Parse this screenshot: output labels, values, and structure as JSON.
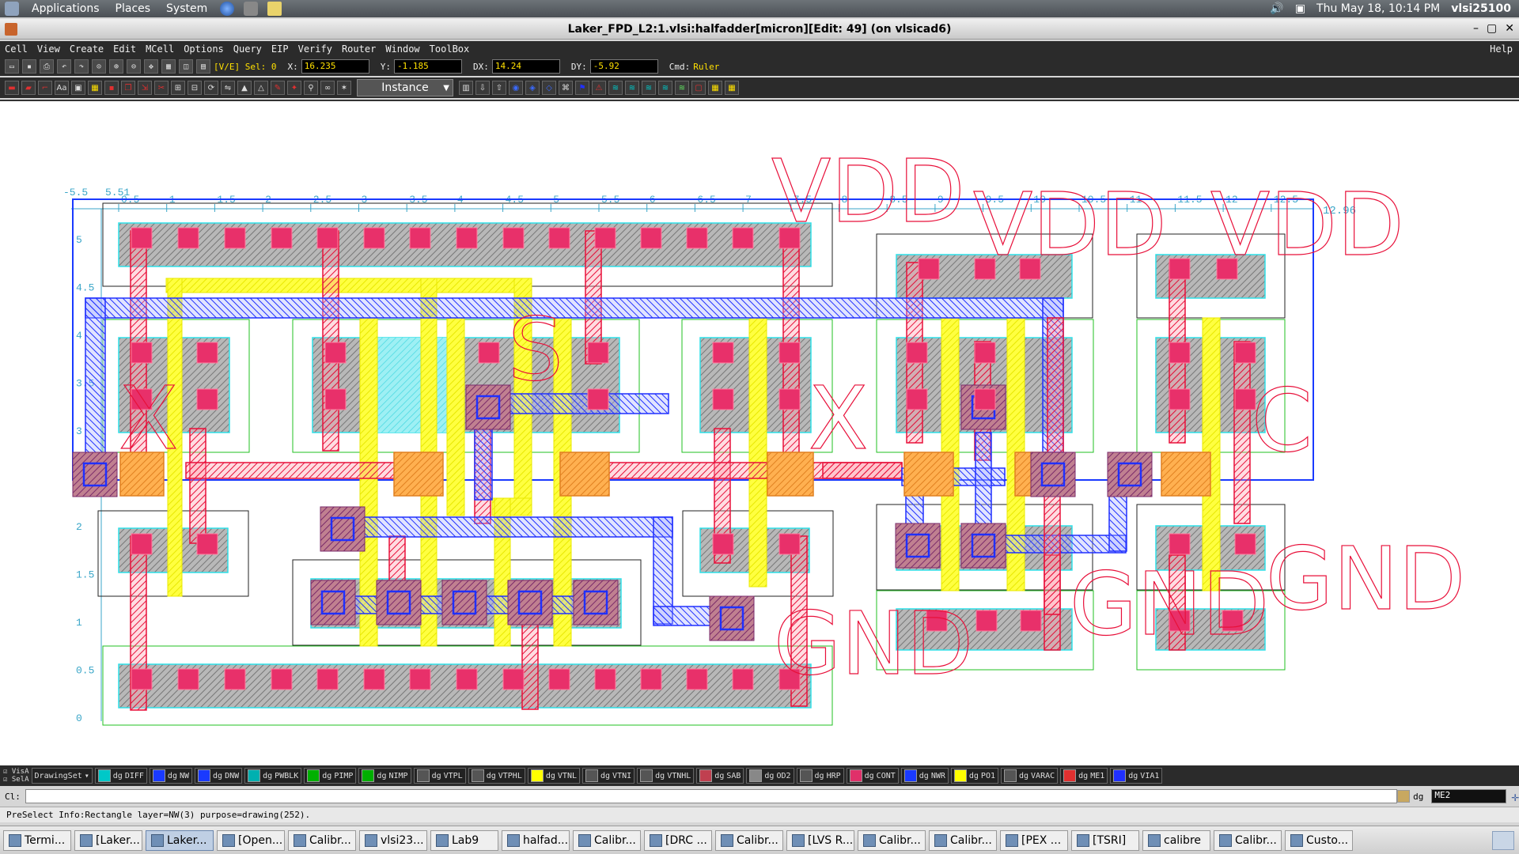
{
  "topbar": {
    "menus": [
      "Applications",
      "Places",
      "System"
    ],
    "datetime": "Thu May 18, 10:14 PM",
    "user": "vlsi25100"
  },
  "window": {
    "title": "Laker_FPD_L2:1.vlsi:halfadder[micron][Edit: 49] (on vlsicad6)"
  },
  "menubar": {
    "items": [
      "Cell",
      "View",
      "Create",
      "Edit",
      "MCell",
      "Options",
      "Query",
      "EIP",
      "Verify",
      "Router",
      "Window",
      "ToolBox"
    ],
    "help": "Help"
  },
  "coords": {
    "mode": "[V/E] Sel: 0",
    "x_label": "X:",
    "x": "16.235",
    "y_label": "Y:",
    "y": "-1.185",
    "dx_label": "DX:",
    "dx": "14.24",
    "dy_label": "DY:",
    "dy": "-5.92",
    "cmd_label": "Cmd:",
    "cmd": "Ruler"
  },
  "toolbar": {
    "instance_select": "Instance"
  },
  "ruler": {
    "top_ticks": [
      "0.5",
      "1",
      "1.5",
      "2",
      "2.5",
      "3",
      "3.5",
      "4",
      "4.5",
      "5",
      "5.5",
      "6",
      "6.5",
      "7",
      "7.5",
      "8",
      "8.5",
      "9",
      "9.5",
      "10",
      "10.5",
      "11",
      "11.5",
      "12",
      "12.5"
    ],
    "top_start": "-5.5",
    "top_start2": "5.51",
    "top_end": "12.96",
    "left_ticks": [
      "5",
      "4.5",
      "4",
      "3.5",
      "3",
      "2.5",
      "2",
      "1.5",
      "1",
      "0.5",
      "0"
    ]
  },
  "layout_labels": {
    "vdd": "VDD",
    "gnd": "GND",
    "s": "S",
    "x": "X",
    "c": "C"
  },
  "layers": {
    "visa": "VisA",
    "sela": "SelA",
    "drawing_set": "DrawingSet",
    "purpose": "dg",
    "items": [
      {
        "name": "DIFF",
        "color": "#00c8c8"
      },
      {
        "name": "NW",
        "color": "#1a3aff"
      },
      {
        "name": "DNW",
        "color": "#1a3aff"
      },
      {
        "name": "PWBLK",
        "color": "#00b0b0"
      },
      {
        "name": "PIMP",
        "color": "#00b000"
      },
      {
        "name": "NIMP",
        "color": "#00b000"
      },
      {
        "name": "VTPL",
        "color": "#555555"
      },
      {
        "name": "VTPHL",
        "color": "#555555"
      },
      {
        "name": "VTNL",
        "color": "#ffff00"
      },
      {
        "name": "VTNI",
        "color": "#555555"
      },
      {
        "name": "VTNHL",
        "color": "#555555"
      },
      {
        "name": "SAB",
        "color": "#c04050"
      },
      {
        "name": "OD2",
        "color": "#888888"
      },
      {
        "name": "HRP",
        "color": "#555555"
      },
      {
        "name": "CONT",
        "color": "#e0306a"
      },
      {
        "name": "NWR",
        "color": "#1a3aff"
      },
      {
        "name": "PO1",
        "color": "#ffff00"
      },
      {
        "name": "VARAC",
        "color": "#555555"
      },
      {
        "name": "ME1",
        "color": "#e03030"
      },
      {
        "name": "VIA1",
        "color": "#2030ff"
      }
    ],
    "current": "ME2"
  },
  "cmdline": {
    "label": "Cl:"
  },
  "status": {
    "text": "PreSelect Info:Rectangle  layer=NW(3) purpose=drawing(252)."
  },
  "taskbar": [
    "Termi...",
    "[Laker...",
    "Laker...",
    "[Open...",
    "Calibr...",
    "vlsi23...",
    "Lab9",
    "halfad...",
    "Calibr...",
    "[DRC ...",
    "Calibr...",
    "[LVS R...",
    "Calibr...",
    "Calibr...",
    "[PEX ...",
    "[TSRI]",
    "calibre",
    "Calibr...",
    "Custo..."
  ]
}
